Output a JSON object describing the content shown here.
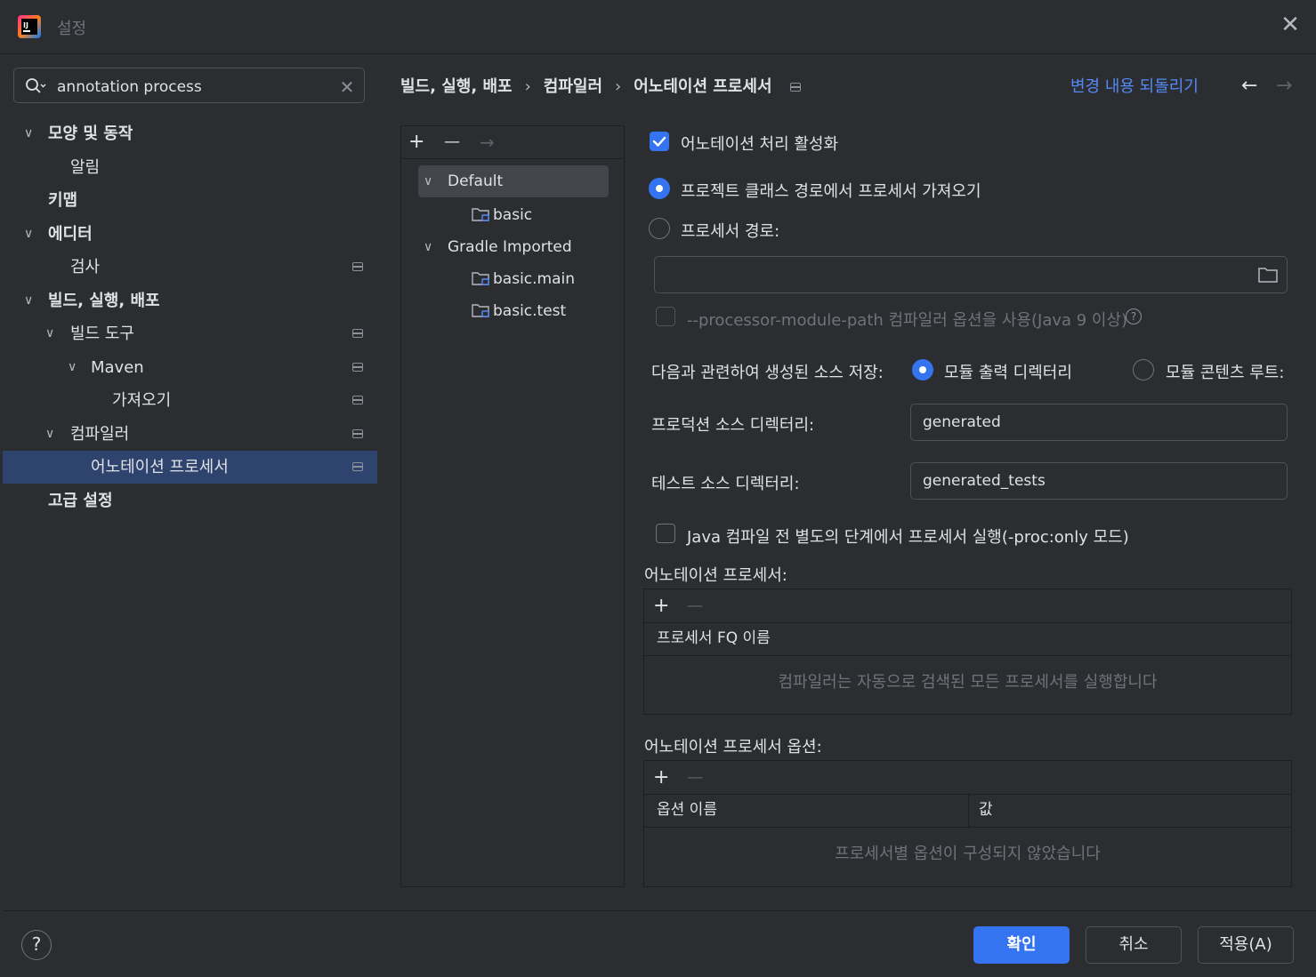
{
  "window": {
    "title": "설정"
  },
  "search": {
    "value": "annotation process"
  },
  "sidebar": {
    "items": [
      {
        "label": "모양 및 동작"
      },
      {
        "label": "알림"
      },
      {
        "label": "키맵"
      },
      {
        "label": "에디터"
      },
      {
        "label": "검사"
      },
      {
        "label": "빌드, 실행, 배포"
      },
      {
        "label": "빌드 도구"
      },
      {
        "label": "Maven"
      },
      {
        "label": "가져오기"
      },
      {
        "label": "컴파일러"
      },
      {
        "label": "어노테이션 프로세서"
      },
      {
        "label": "고급 설정"
      }
    ]
  },
  "breadcrumb": {
    "items": [
      "빌드, 실행, 배포",
      "컴파일러",
      "어노테이션 프로세서"
    ],
    "separator": "›"
  },
  "header": {
    "reset_label": "변경 내용 되돌리기"
  },
  "profiles": {
    "toolbar": {
      "add": "+",
      "remove": "—",
      "move": "→"
    },
    "items": [
      "Default",
      "basic",
      "Gradle Imported",
      "basic.main",
      "basic.test"
    ]
  },
  "settings": {
    "enable_label": "어노테이션 처리 활성화",
    "from_classpath_label": "프로젝트 클래스 경로에서 프로세서 가져오기",
    "processor_path_label": "프로세서 경로:",
    "processor_path_value": "",
    "module_path_label": "--processor-module-path 컴파일러 옵션을 사용(Java 9 이상)",
    "store_sources_label": "다음과 관련하여 생성된 소스 저장:",
    "module_output_label": "모듈 출력 디렉터리",
    "module_content_root_label": "모듈 콘텐츠 루트:",
    "production_dir_label": "프로덕션 소스 디렉터리:",
    "production_dir_value": "generated",
    "test_dir_label": "테스트 소스 디렉터리:",
    "test_dir_value": "generated_tests",
    "proc_only_label": "Java 컴파일 전 별도의 단계에서 프로세서 실행(-proc:only 모드)"
  },
  "processors_table": {
    "title": "어노테이션 프로세서:",
    "column": "프로세서 FQ 이름",
    "empty_text": "컴파일러는 자동으로 검색된 모든 프로세서를 실행합니다"
  },
  "options_table": {
    "title": "어노테이션 프로세서 옵션:",
    "columns": [
      "옵션 이름",
      "값"
    ],
    "empty_text": "프로세서별 옵션이 구성되지 않았습니다"
  },
  "footer": {
    "ok_label": "확인",
    "cancel_label": "취소",
    "apply_label": "적용(A)",
    "help": "?"
  },
  "colors": {
    "accent": "#3574f0",
    "selection": "#2e436e",
    "link": "#548af7",
    "background": "#2b2d30"
  }
}
